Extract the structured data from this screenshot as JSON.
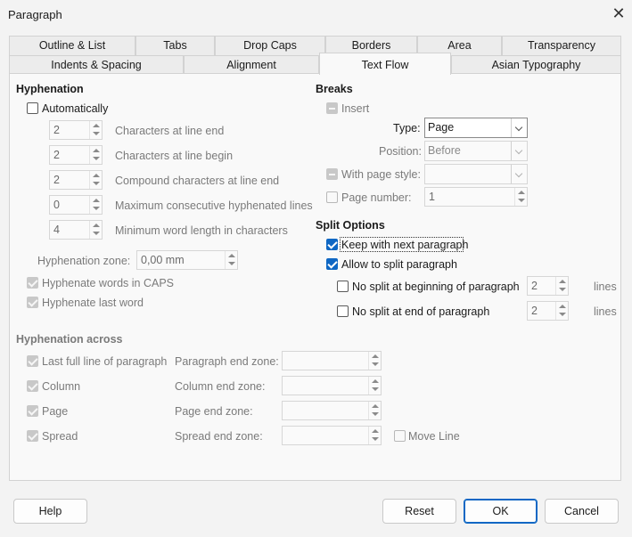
{
  "window": {
    "title": "Paragraph"
  },
  "tabs_row1": [
    "Outline & List",
    "Tabs",
    "Drop Caps",
    "Borders",
    "Area",
    "Transparency"
  ],
  "tabs_row2": [
    "Indents & Spacing",
    "Alignment",
    "Text Flow",
    "Asian Typography"
  ],
  "active_tab": "Text Flow",
  "hyphenation": {
    "header": "Hyphenation",
    "automatically": "Automatically",
    "fields": [
      {
        "value": "2",
        "label": "Characters at line end"
      },
      {
        "value": "2",
        "label": "Characters at line begin"
      },
      {
        "value": "2",
        "label": "Compound characters at line end"
      },
      {
        "value": "0",
        "label": "Maximum consecutive hyphenated lines"
      },
      {
        "value": "4",
        "label": "Minimum word length in characters"
      }
    ],
    "zone_label": "Hyphenation zone:",
    "zone_value": "0,00 mm",
    "caps": "Hyphenate words in CAPS",
    "last_word": "Hyphenate last word"
  },
  "hyphenation_across": {
    "header": "Hyphenation across",
    "rows": [
      {
        "check": "Last full line of paragraph",
        "zone": "Paragraph end zone:"
      },
      {
        "check": "Column",
        "zone": "Column end zone:"
      },
      {
        "check": "Page",
        "zone": "Page end zone:"
      },
      {
        "check": "Spread",
        "zone": "Spread end zone:"
      }
    ],
    "move_line": "Move Line"
  },
  "breaks": {
    "header": "Breaks",
    "insert": "Insert",
    "type_label": "Type:",
    "type_value": "Page",
    "position_label": "Position:",
    "position_value": "Before",
    "page_style": "With page style:",
    "page_number": "Page number:",
    "page_number_value": "1"
  },
  "split": {
    "header": "Split Options",
    "keep": "Keep with next paragraph",
    "allow": "Allow to split paragraph",
    "no_begin": "No split at beginning of paragraph",
    "no_begin_value": "2",
    "no_end": "No split at end of paragraph",
    "no_end_value": "2",
    "lines": "lines"
  },
  "buttons": {
    "help": "Help",
    "reset": "Reset",
    "ok": "OK",
    "cancel": "Cancel"
  },
  "colors": {
    "accent": "#0f67c4"
  }
}
